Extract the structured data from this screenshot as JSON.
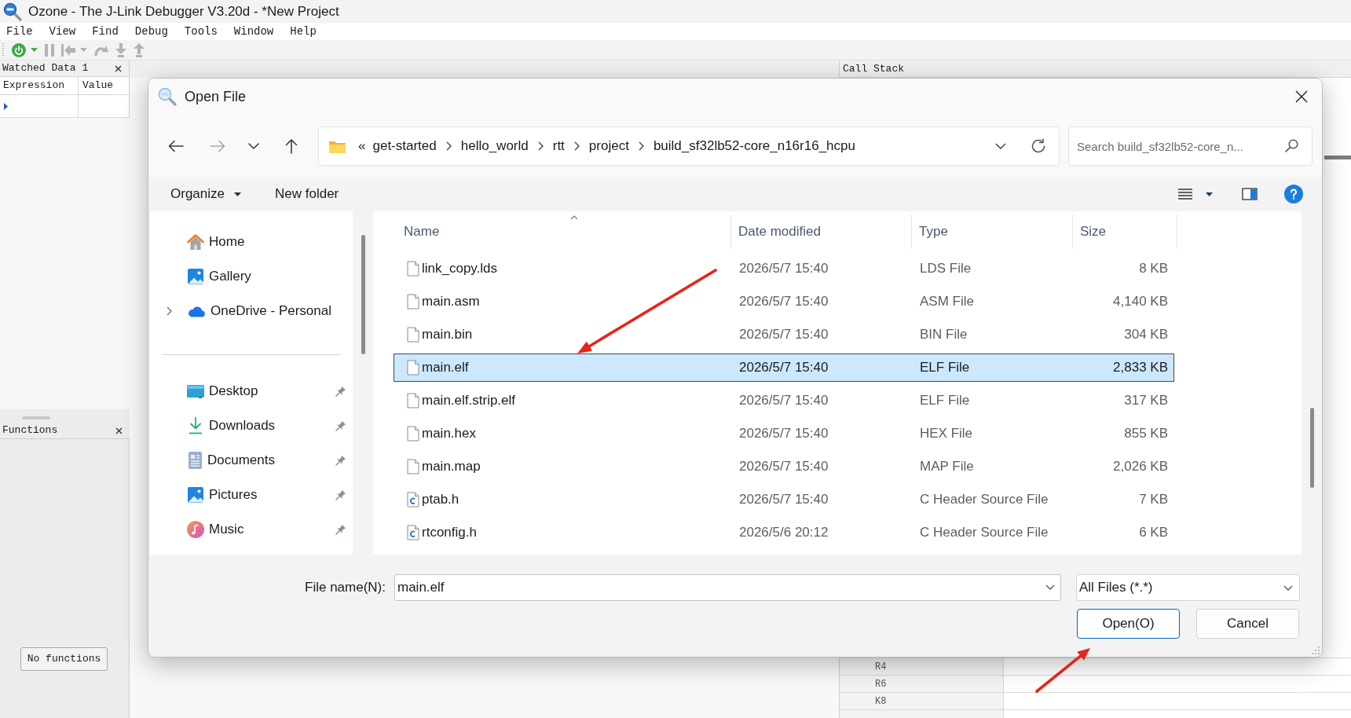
{
  "app": {
    "title": "Ozone - The J-Link Debugger V3.20d - *New Project",
    "menu": [
      "File",
      "View",
      "Find",
      "Debug",
      "Tools",
      "Window",
      "Help"
    ],
    "toolbar": [
      {
        "kind": "power",
        "disabled": false,
        "dropdown": true
      },
      {
        "kind": "pause",
        "disabled": true,
        "dropdown": false
      },
      {
        "kind": "reset",
        "disabled": true,
        "dropdown": true
      },
      {
        "kind": "step_over",
        "disabled": true,
        "dropdown": false
      },
      {
        "kind": "step_into",
        "disabled": true,
        "dropdown": false
      },
      {
        "kind": "step_out",
        "disabled": true,
        "dropdown": false
      }
    ],
    "watched_data": {
      "title": "Watched Data 1",
      "columns": [
        "Expression",
        "Value"
      ]
    },
    "call_stack": {
      "title": "Call Stack"
    },
    "functions": {
      "title": "Functions",
      "button": "No functions"
    },
    "registers": {
      "rows": [
        "R4",
        "R6",
        "K8"
      ]
    }
  },
  "dialog": {
    "title": "Open File",
    "nav_buttons": [
      {
        "kind": "back",
        "disabled": false
      },
      {
        "kind": "forward",
        "disabled": true
      },
      {
        "kind": "recent",
        "disabled": false
      },
      {
        "kind": "up",
        "disabled": false
      }
    ],
    "address": {
      "overflow": "«",
      "crumbs": [
        "get-started",
        "hello_world",
        "rtt",
        "project",
        "build_sf32lb52-core_n16r16_hcpu"
      ]
    },
    "search": {
      "placeholder": "Search build_sf32lb52-core_n..."
    },
    "commands": [
      {
        "label": "Organize",
        "dropdown": true
      },
      {
        "label": "New folder",
        "dropdown": false
      }
    ],
    "nav": [
      {
        "items": [
          {
            "label": "Home",
            "expandable": false,
            "pinned": false
          },
          {
            "label": "Gallery",
            "expandable": false,
            "pinned": false
          },
          {
            "label": "OneDrive - Personal",
            "expandable": true,
            "pinned": false
          }
        ]
      },
      {
        "items": [
          {
            "label": "Desktop",
            "expandable": false,
            "pinned": true
          },
          {
            "label": "Downloads",
            "expandable": false,
            "pinned": true
          },
          {
            "label": "Documents",
            "expandable": false,
            "pinned": true
          },
          {
            "label": "Pictures",
            "expandable": false,
            "pinned": true
          },
          {
            "label": "Music",
            "expandable": false,
            "pinned": true
          }
        ]
      }
    ],
    "file_list": {
      "columns": [
        {
          "label": "Name",
          "sorted": true
        },
        {
          "label": "Date modified",
          "sorted": false
        },
        {
          "label": "Type",
          "sorted": false
        },
        {
          "label": "Size",
          "sorted": false
        }
      ],
      "rows": [
        {
          "kind": "file",
          "name": "link_copy.lds",
          "date": "2026/5/7 15:40",
          "type": "LDS File",
          "size": "8 KB",
          "selected": false
        },
        {
          "kind": "file",
          "name": "main.asm",
          "date": "2026/5/7 15:40",
          "type": "ASM File",
          "size": "4,140 KB",
          "selected": false
        },
        {
          "kind": "file",
          "name": "main.bin",
          "date": "2026/5/7 15:40",
          "type": "BIN File",
          "size": "304 KB",
          "selected": false
        },
        {
          "kind": "file",
          "name": "main.elf",
          "date": "2026/5/7 15:40",
          "type": "ELF File",
          "size": "2,833 KB",
          "selected": true
        },
        {
          "kind": "file",
          "name": "main.elf.strip.elf",
          "date": "2026/5/7 15:40",
          "type": "ELF File",
          "size": "317 KB",
          "selected": false
        },
        {
          "kind": "file",
          "name": "main.hex",
          "date": "2026/5/7 15:40",
          "type": "HEX File",
          "size": "855 KB",
          "selected": false
        },
        {
          "kind": "file",
          "name": "main.map",
          "date": "2026/5/7 15:40",
          "type": "MAP File",
          "size": "2,026 KB",
          "selected": false
        },
        {
          "kind": "c_header",
          "name": "ptab.h",
          "date": "2026/5/7 15:40",
          "type": "C Header Source File",
          "size": "7 KB",
          "selected": false
        },
        {
          "kind": "c_header",
          "name": "rtconfig.h",
          "date": "2026/5/6 20:12",
          "type": "C Header Source File",
          "size": "6 KB",
          "selected": false
        }
      ]
    },
    "file_name": {
      "label": "File name(N):",
      "value": "main.elf"
    },
    "file_type": {
      "value": "All Files (*.*)"
    },
    "buttons": [
      {
        "label": "Open(O)",
        "default": true
      },
      {
        "label": "Cancel",
        "default": false
      }
    ]
  }
}
